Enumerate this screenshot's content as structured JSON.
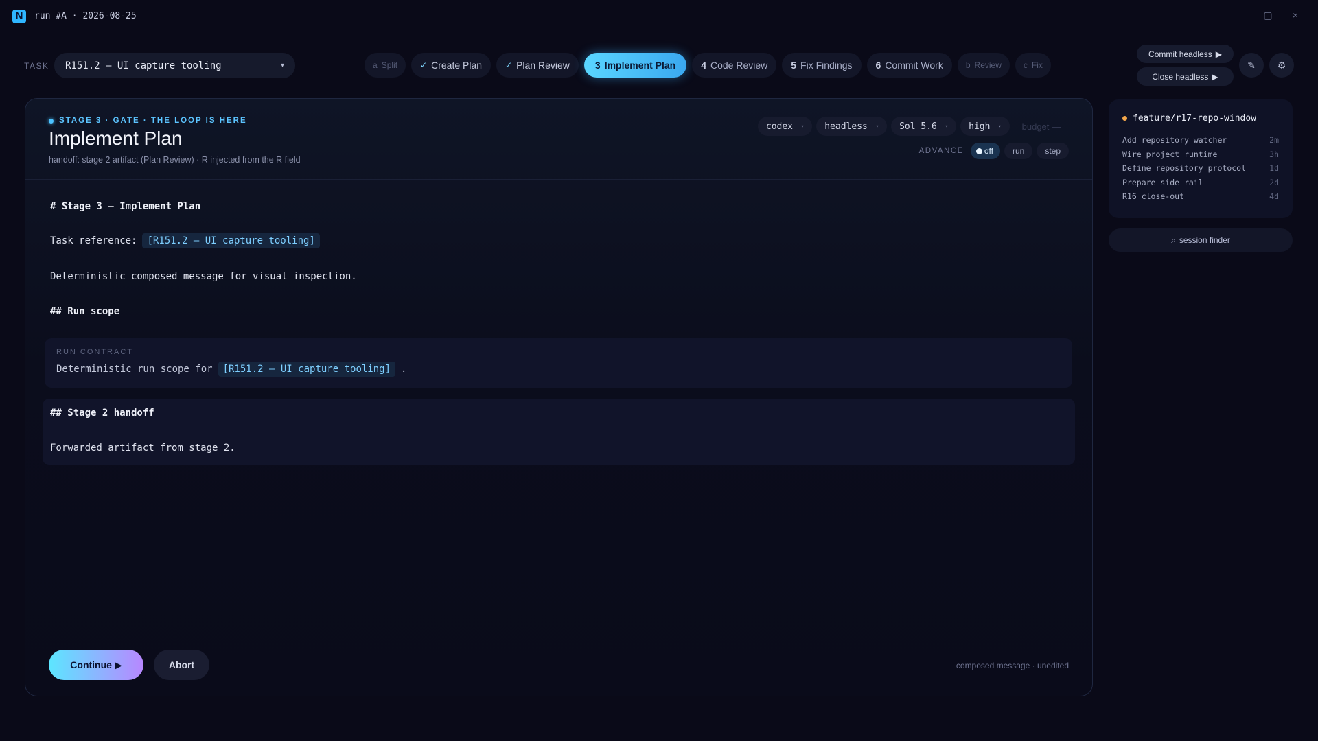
{
  "window": {
    "logo": "N",
    "title": "run #A · 2026-08-25",
    "controls": {
      "minimize": "–",
      "maximize": "▢",
      "close": "×"
    }
  },
  "task": {
    "label": "TASK",
    "value": "R151.2 — UI capture tooling",
    "caret": "▾"
  },
  "stages": [
    {
      "key": "a",
      "label": "Split",
      "state": "minor"
    },
    {
      "key": "✓",
      "label": "Create Plan",
      "state": "done"
    },
    {
      "key": "✓",
      "label": "Plan Review",
      "state": "done"
    },
    {
      "key": "3",
      "label": "Implement Plan",
      "state": "active"
    },
    {
      "key": "4",
      "label": "Code Review",
      "state": "pending"
    },
    {
      "key": "5",
      "label": "Fix Findings",
      "state": "pending"
    },
    {
      "key": "6",
      "label": "Commit Work",
      "state": "pending"
    },
    {
      "key": "b",
      "label": "Review",
      "state": "minor"
    },
    {
      "key": "c",
      "label": "Fix",
      "state": "minor"
    }
  ],
  "actions": {
    "commit_headless": "Commit headless",
    "close_headless": "Close headless",
    "play_glyph": "▶",
    "edit_glyph": "✎",
    "settings_glyph": "⚙"
  },
  "panel": {
    "eyebrow": "STAGE 3 · GATE · THE LOOP IS HERE",
    "title": "Implement Plan",
    "handoff": "handoff: stage 2 artifact (Plan Review) · R injected from the R field",
    "selectors": {
      "agent": "codex",
      "mode": "headless",
      "model": "Sol 5.6",
      "effort": "high",
      "budget": "budget —",
      "caret": "▾"
    },
    "advance": {
      "label": "ADVANCE",
      "off": "off",
      "run": "run",
      "step": "step"
    }
  },
  "message": {
    "h1": "# Stage 3 — Implement Plan",
    "ref_prefix": "Task reference:",
    "ref_chip": "[R151.2 — UI capture tooling]",
    "desc": "Deterministic composed message for visual inspection.",
    "h2_scope": "## Run scope",
    "contract_label": "RUN CONTRACT",
    "contract_prefix": "Deterministic run scope for",
    "contract_chip": "[R151.2 — UI capture tooling]",
    "contract_suffix": ".",
    "h2_handoff": "## Stage 2 handoff",
    "handoff_text": "Forwarded artifact from stage 2."
  },
  "footer": {
    "continue": "Continue",
    "continue_glyph": "▶",
    "abort": "Abort",
    "note": "composed message · unedited"
  },
  "rail": {
    "branch": "feature/r17-repo-window",
    "branch_dot_color": "#f3a64a",
    "commits": [
      {
        "msg": "Add repository watcher",
        "age": "2m"
      },
      {
        "msg": "Wire project runtime",
        "age": "3h"
      },
      {
        "msg": "Define repository protocol",
        "age": "1d"
      },
      {
        "msg": "Prepare side rail",
        "age": "2d"
      },
      {
        "msg": "R16 close-out",
        "age": "4d"
      }
    ],
    "session_finder_glyph": "⌕",
    "session_finder": "session finder"
  },
  "colors": {
    "background": "#0a0a18",
    "accent": "#4cc2ff",
    "chip_text": "#7ecfff"
  }
}
